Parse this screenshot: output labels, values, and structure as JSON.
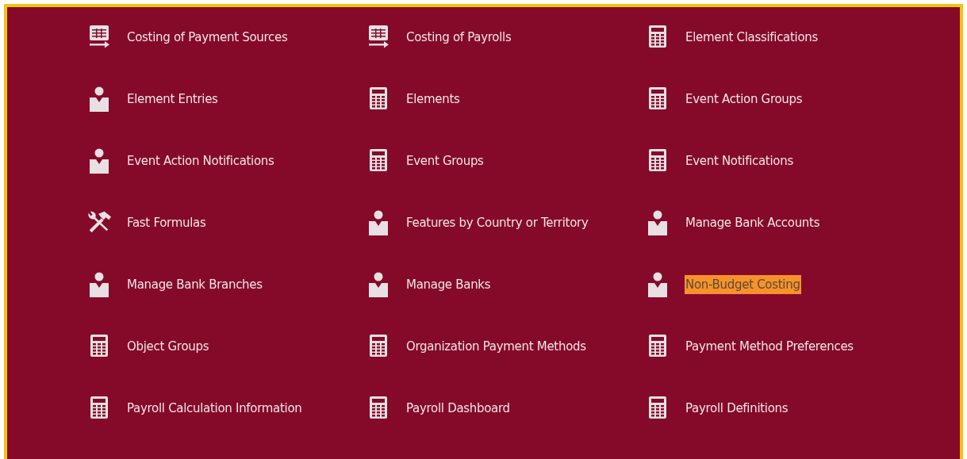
{
  "tasks": [
    {
      "label": "Costing of Payment Sources",
      "kind": "sheet",
      "highlighted": false
    },
    {
      "label": "Costing of Payrolls",
      "kind": "sheet",
      "highlighted": false
    },
    {
      "label": "Element Classifications",
      "kind": "calculation",
      "highlighted": false
    },
    {
      "label": "Element Entries",
      "kind": "people",
      "highlighted": false
    },
    {
      "label": "Elements",
      "kind": "calculation",
      "highlighted": false
    },
    {
      "label": "Event Action Groups",
      "kind": "calculation",
      "highlighted": false
    },
    {
      "label": "Event Action Notifications",
      "kind": "people",
      "highlighted": false
    },
    {
      "label": "Event Groups",
      "kind": "calculation",
      "highlighted": false
    },
    {
      "label": "Event Notifications",
      "kind": "calculation",
      "highlighted": false
    },
    {
      "label": "Fast Formulas",
      "kind": "setup",
      "highlighted": false
    },
    {
      "label": "Features by Country or Territory",
      "kind": "people",
      "highlighted": false
    },
    {
      "label": "Manage Bank Accounts",
      "kind": "people",
      "highlighted": false
    },
    {
      "label": "Manage Bank Branches",
      "kind": "people",
      "highlighted": false
    },
    {
      "label": "Manage Banks",
      "kind": "people",
      "highlighted": false
    },
    {
      "label": "Non-Budget Costing",
      "kind": "people",
      "highlighted": true
    },
    {
      "label": "Object Groups",
      "kind": "calculation",
      "highlighted": false
    },
    {
      "label": "Organization Payment Methods",
      "kind": "calculation",
      "highlighted": false
    },
    {
      "label": "Payment Method Preferences",
      "kind": "calculation",
      "highlighted": false
    },
    {
      "label": "Payroll Calculation Information",
      "kind": "calculation",
      "highlighted": false
    },
    {
      "label": "Payroll Dashboard",
      "kind": "calculation",
      "highlighted": false
    },
    {
      "label": "Payroll Definitions",
      "kind": "calculation",
      "highlighted": false
    }
  ]
}
